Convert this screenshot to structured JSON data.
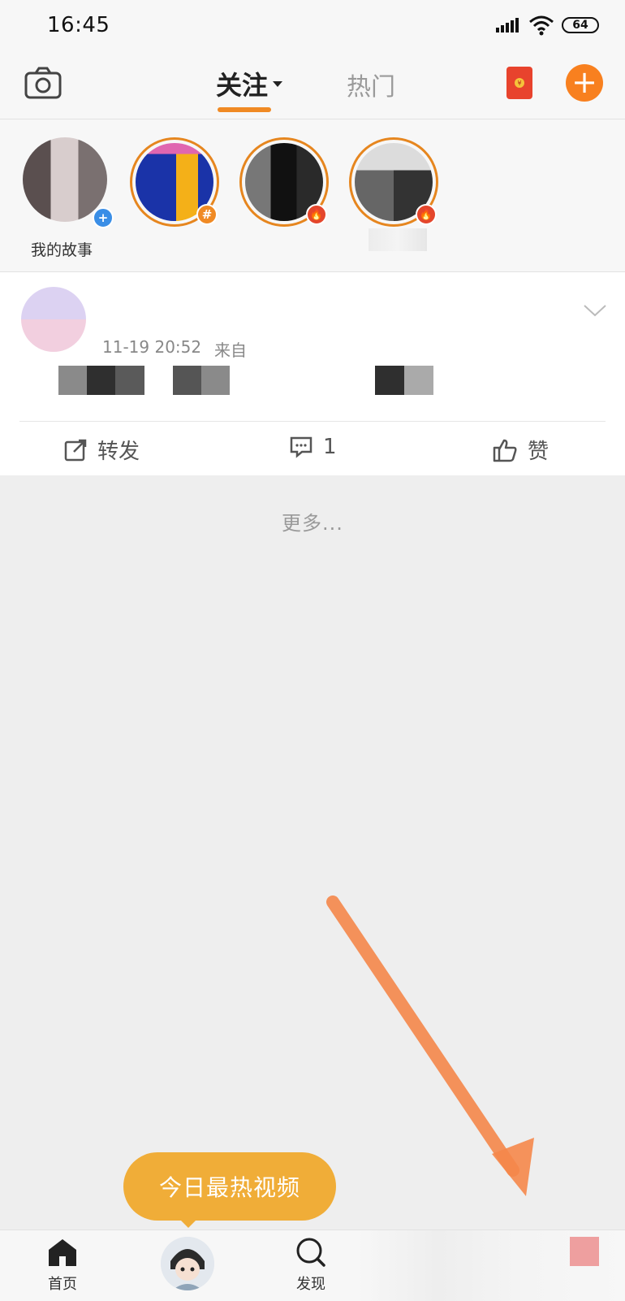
{
  "status_bar": {
    "time": "16:45",
    "battery": "64"
  },
  "header": {
    "tabs": [
      {
        "label": "关注",
        "active": true
      },
      {
        "label": "热门",
        "active": false
      }
    ],
    "add_icon": "plus-icon",
    "camera_icon": "camera-icon",
    "red_packet_icon": "red-packet-icon"
  },
  "stories": {
    "my_story_label": "我的故事",
    "items": [
      {
        "badge": "+",
        "badge_color": "#3a8ee6"
      },
      {
        "badge": "#",
        "badge_color": "#f08a24"
      },
      {
        "badge": "fire",
        "badge_color": "#e4462c"
      },
      {
        "badge": "fire",
        "badge_color": "#e4462c"
      }
    ]
  },
  "post": {
    "time": "11-19 20:52",
    "source": "来自",
    "actions": {
      "repost": "转发",
      "comment_count": "1",
      "like": "赞"
    }
  },
  "more_text": "更多...",
  "hot_video_button": "今日最热视频",
  "bottom_nav": {
    "home": "首页",
    "discover": "发现"
  },
  "colors": {
    "accent": "#f08a24",
    "pill": "#f0ad38",
    "add_button": "#f8801f"
  }
}
